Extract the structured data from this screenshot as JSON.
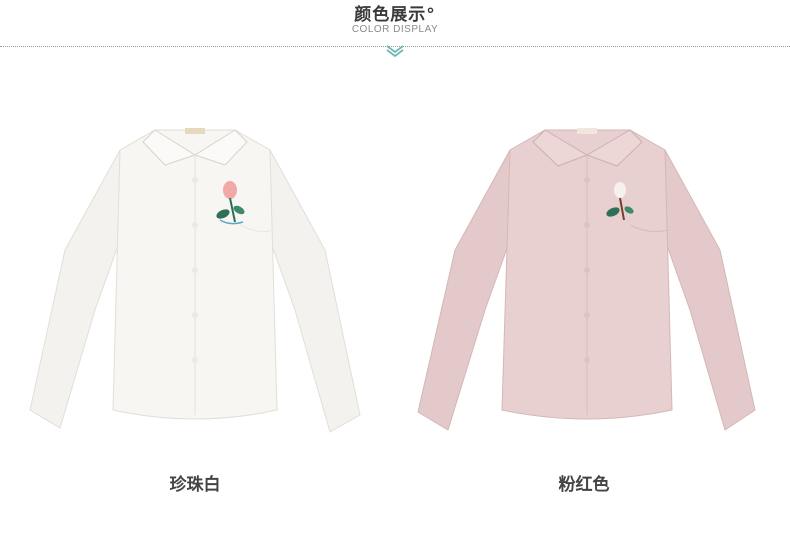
{
  "header": {
    "title": "颜色展示°",
    "subtitle": "COLOR DISPLAY"
  },
  "colors": {
    "white_shirt": "#f7f5f2",
    "pink_shirt": "#e8cfcf",
    "accent_teal": "#6fb7b3",
    "embroidery_pink": "#f0a9a6",
    "embroidery_leaf": "#2f6f55"
  },
  "products": [
    {
      "caption": "珍珠白"
    },
    {
      "caption": "粉红色"
    }
  ]
}
